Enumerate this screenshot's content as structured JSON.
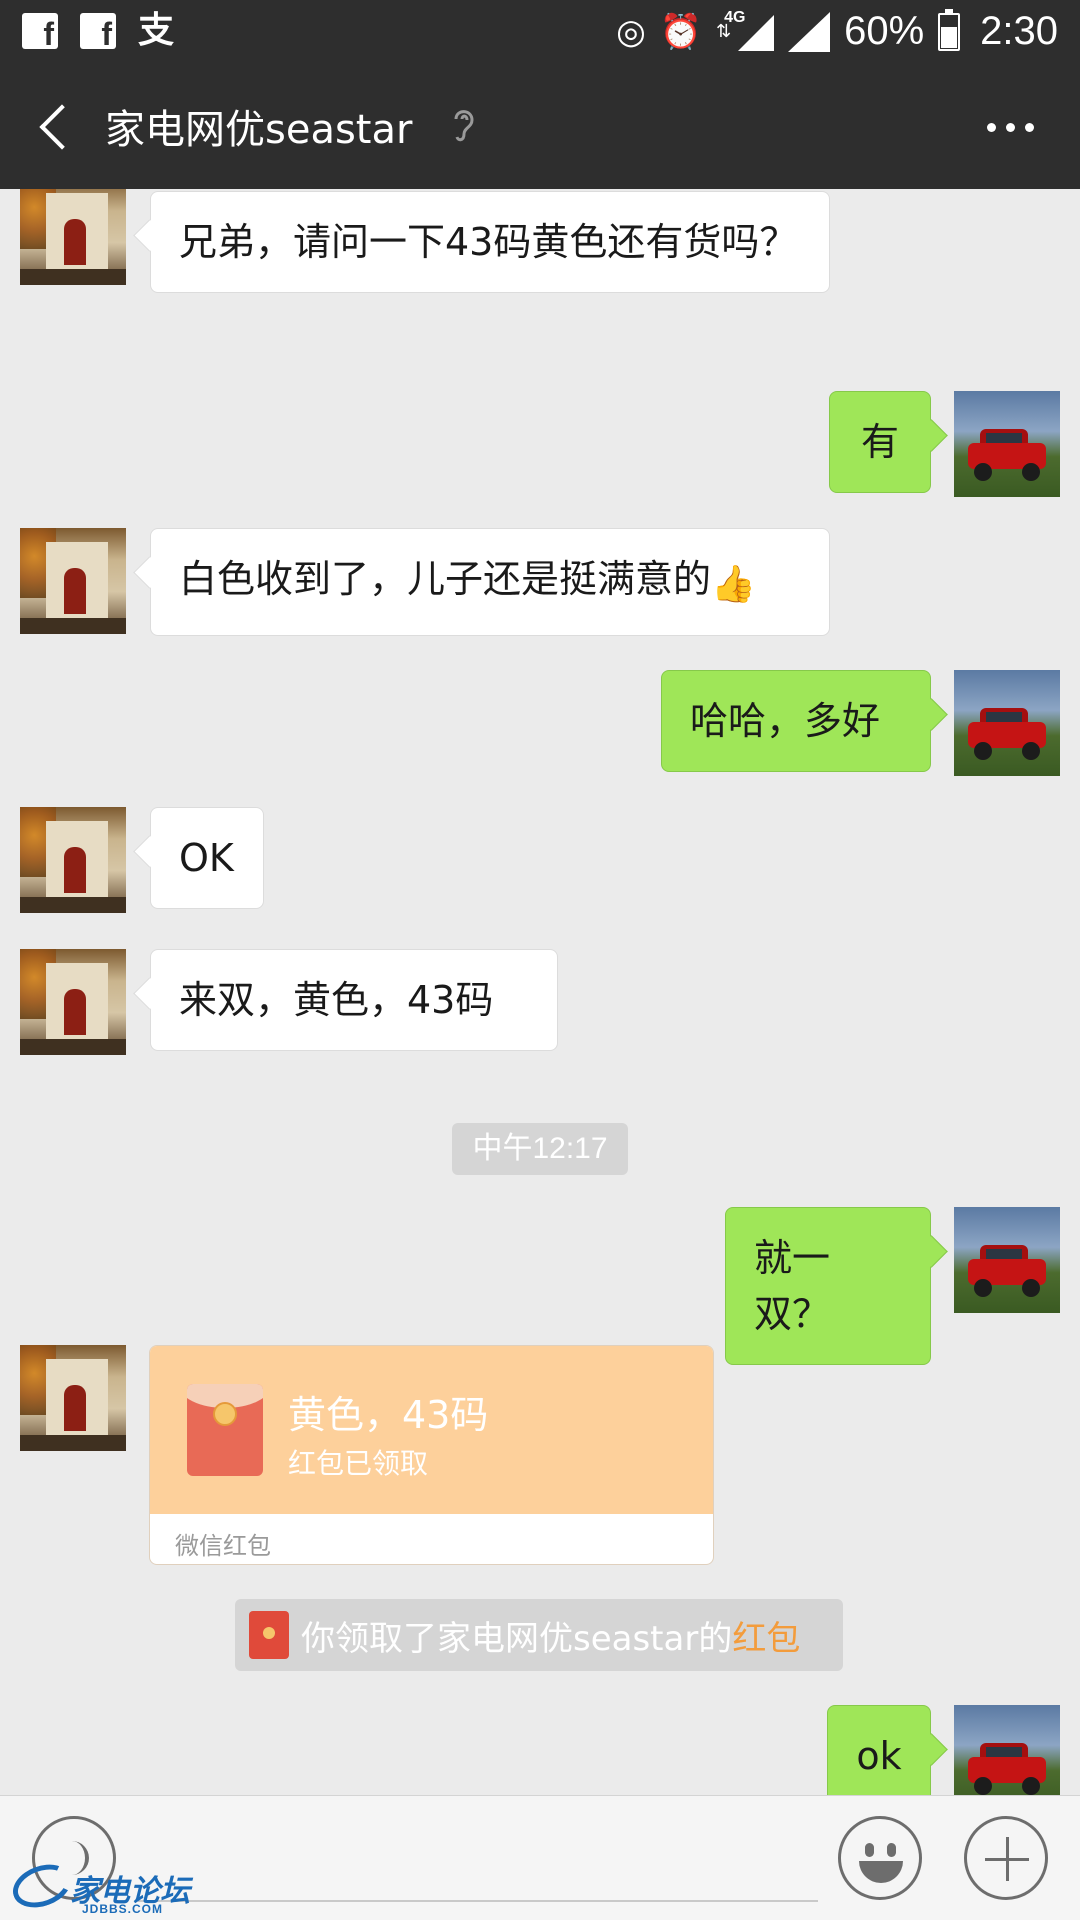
{
  "status_bar": {
    "left_icons": [
      "facebook-icon",
      "facebook-icon",
      "alipay-icon"
    ],
    "right_icons": [
      "hotspot-icon",
      "alarm-icon",
      "4g-signal-icon",
      "signal-icon",
      "battery-icon"
    ],
    "network": "4G",
    "battery": "60%",
    "battery_level": 0.6,
    "time": "2:30"
  },
  "header": {
    "title": "家电网优seastar",
    "back_icon": "chevron-left-icon",
    "ear_icon": "ear-icon",
    "more_icon": "more-dots-icon"
  },
  "messages": [
    {
      "side": "in",
      "text": "兄弟，请问一下43码黄色还有货吗？"
    },
    {
      "side": "out",
      "text": "有"
    },
    {
      "side": "in",
      "text": "白色收到了，儿子还是挺满意的",
      "emoji": "👍"
    },
    {
      "side": "out",
      "text": "哈哈，多好"
    },
    {
      "side": "in",
      "text": "OK"
    },
    {
      "side": "in",
      "text": "来双，黄色，43码"
    },
    {
      "side": "out",
      "text": "就一双？"
    },
    {
      "side": "out",
      "text": "ok"
    }
  ],
  "timestamp": "中午12:17",
  "red_packet": {
    "title": "黄色，43码",
    "status": "红包已领取",
    "footer": "微信红包",
    "colors": {
      "top": "#fdd09b",
      "envelope": "#e86a56"
    }
  },
  "system_notice": {
    "text": "你领取了家电网优seastar的",
    "link": "红包",
    "link_color": "#f39c3c"
  },
  "input_bar": {
    "voice_icon": "voice-icon",
    "emoji_icon": "emoji-icon",
    "plus_icon": "plus-icon"
  },
  "watermark": {
    "text": "家电论坛",
    "sub": "JDBBS.COM"
  },
  "colors": {
    "bar": "#2e2e2e",
    "background": "#ebebeb",
    "outgoing_bubble": "#9fe658",
    "incoming_bubble": "#ffffff"
  }
}
